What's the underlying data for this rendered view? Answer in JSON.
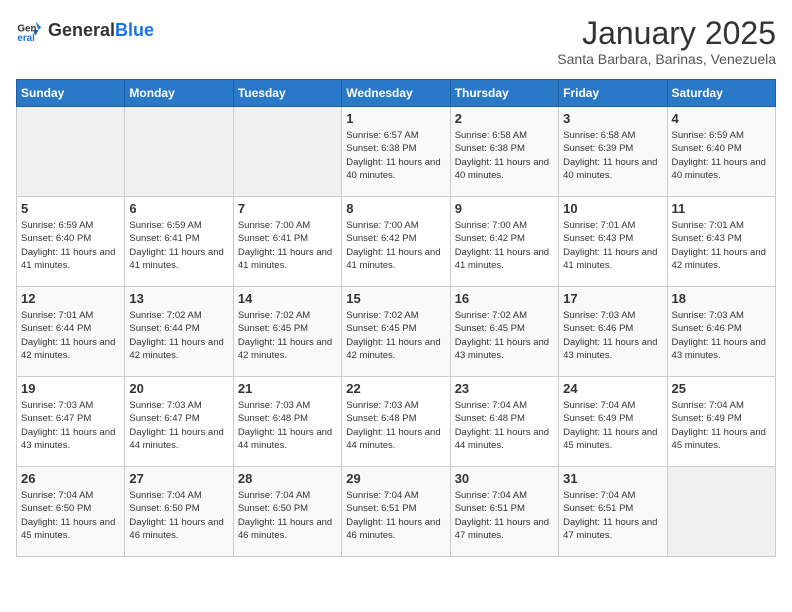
{
  "header": {
    "logo_general": "General",
    "logo_blue": "Blue",
    "title": "January 2025",
    "subtitle": "Santa Barbara, Barinas, Venezuela"
  },
  "days_of_week": [
    "Sunday",
    "Monday",
    "Tuesday",
    "Wednesday",
    "Thursday",
    "Friday",
    "Saturday"
  ],
  "weeks": [
    [
      {
        "day": null,
        "sunrise": null,
        "sunset": null,
        "daylight": null
      },
      {
        "day": null,
        "sunrise": null,
        "sunset": null,
        "daylight": null
      },
      {
        "day": null,
        "sunrise": null,
        "sunset": null,
        "daylight": null
      },
      {
        "day": "1",
        "sunrise": "6:57 AM",
        "sunset": "6:38 PM",
        "daylight": "11 hours and 40 minutes."
      },
      {
        "day": "2",
        "sunrise": "6:58 AM",
        "sunset": "6:38 PM",
        "daylight": "11 hours and 40 minutes."
      },
      {
        "day": "3",
        "sunrise": "6:58 AM",
        "sunset": "6:39 PM",
        "daylight": "11 hours and 40 minutes."
      },
      {
        "day": "4",
        "sunrise": "6:59 AM",
        "sunset": "6:40 PM",
        "daylight": "11 hours and 40 minutes."
      }
    ],
    [
      {
        "day": "5",
        "sunrise": "6:59 AM",
        "sunset": "6:40 PM",
        "daylight": "11 hours and 41 minutes."
      },
      {
        "day": "6",
        "sunrise": "6:59 AM",
        "sunset": "6:41 PM",
        "daylight": "11 hours and 41 minutes."
      },
      {
        "day": "7",
        "sunrise": "7:00 AM",
        "sunset": "6:41 PM",
        "daylight": "11 hours and 41 minutes."
      },
      {
        "day": "8",
        "sunrise": "7:00 AM",
        "sunset": "6:42 PM",
        "daylight": "11 hours and 41 minutes."
      },
      {
        "day": "9",
        "sunrise": "7:00 AM",
        "sunset": "6:42 PM",
        "daylight": "11 hours and 41 minutes."
      },
      {
        "day": "10",
        "sunrise": "7:01 AM",
        "sunset": "6:43 PM",
        "daylight": "11 hours and 41 minutes."
      },
      {
        "day": "11",
        "sunrise": "7:01 AM",
        "sunset": "6:43 PM",
        "daylight": "11 hours and 42 minutes."
      }
    ],
    [
      {
        "day": "12",
        "sunrise": "7:01 AM",
        "sunset": "6:44 PM",
        "daylight": "11 hours and 42 minutes."
      },
      {
        "day": "13",
        "sunrise": "7:02 AM",
        "sunset": "6:44 PM",
        "daylight": "11 hours and 42 minutes."
      },
      {
        "day": "14",
        "sunrise": "7:02 AM",
        "sunset": "6:45 PM",
        "daylight": "11 hours and 42 minutes."
      },
      {
        "day": "15",
        "sunrise": "7:02 AM",
        "sunset": "6:45 PM",
        "daylight": "11 hours and 42 minutes."
      },
      {
        "day": "16",
        "sunrise": "7:02 AM",
        "sunset": "6:45 PM",
        "daylight": "11 hours and 43 minutes."
      },
      {
        "day": "17",
        "sunrise": "7:03 AM",
        "sunset": "6:46 PM",
        "daylight": "11 hours and 43 minutes."
      },
      {
        "day": "18",
        "sunrise": "7:03 AM",
        "sunset": "6:46 PM",
        "daylight": "11 hours and 43 minutes."
      }
    ],
    [
      {
        "day": "19",
        "sunrise": "7:03 AM",
        "sunset": "6:47 PM",
        "daylight": "11 hours and 43 minutes."
      },
      {
        "day": "20",
        "sunrise": "7:03 AM",
        "sunset": "6:47 PM",
        "daylight": "11 hours and 44 minutes."
      },
      {
        "day": "21",
        "sunrise": "7:03 AM",
        "sunset": "6:48 PM",
        "daylight": "11 hours and 44 minutes."
      },
      {
        "day": "22",
        "sunrise": "7:03 AM",
        "sunset": "6:48 PM",
        "daylight": "11 hours and 44 minutes."
      },
      {
        "day": "23",
        "sunrise": "7:04 AM",
        "sunset": "6:48 PM",
        "daylight": "11 hours and 44 minutes."
      },
      {
        "day": "24",
        "sunrise": "7:04 AM",
        "sunset": "6:49 PM",
        "daylight": "11 hours and 45 minutes."
      },
      {
        "day": "25",
        "sunrise": "7:04 AM",
        "sunset": "6:49 PM",
        "daylight": "11 hours and 45 minutes."
      }
    ],
    [
      {
        "day": "26",
        "sunrise": "7:04 AM",
        "sunset": "6:50 PM",
        "daylight": "11 hours and 45 minutes."
      },
      {
        "day": "27",
        "sunrise": "7:04 AM",
        "sunset": "6:50 PM",
        "daylight": "11 hours and 46 minutes."
      },
      {
        "day": "28",
        "sunrise": "7:04 AM",
        "sunset": "6:50 PM",
        "daylight": "11 hours and 46 minutes."
      },
      {
        "day": "29",
        "sunrise": "7:04 AM",
        "sunset": "6:51 PM",
        "daylight": "11 hours and 46 minutes."
      },
      {
        "day": "30",
        "sunrise": "7:04 AM",
        "sunset": "6:51 PM",
        "daylight": "11 hours and 47 minutes."
      },
      {
        "day": "31",
        "sunrise": "7:04 AM",
        "sunset": "6:51 PM",
        "daylight": "11 hours and 47 minutes."
      },
      {
        "day": null,
        "sunrise": null,
        "sunset": null,
        "daylight": null
      }
    ]
  ]
}
